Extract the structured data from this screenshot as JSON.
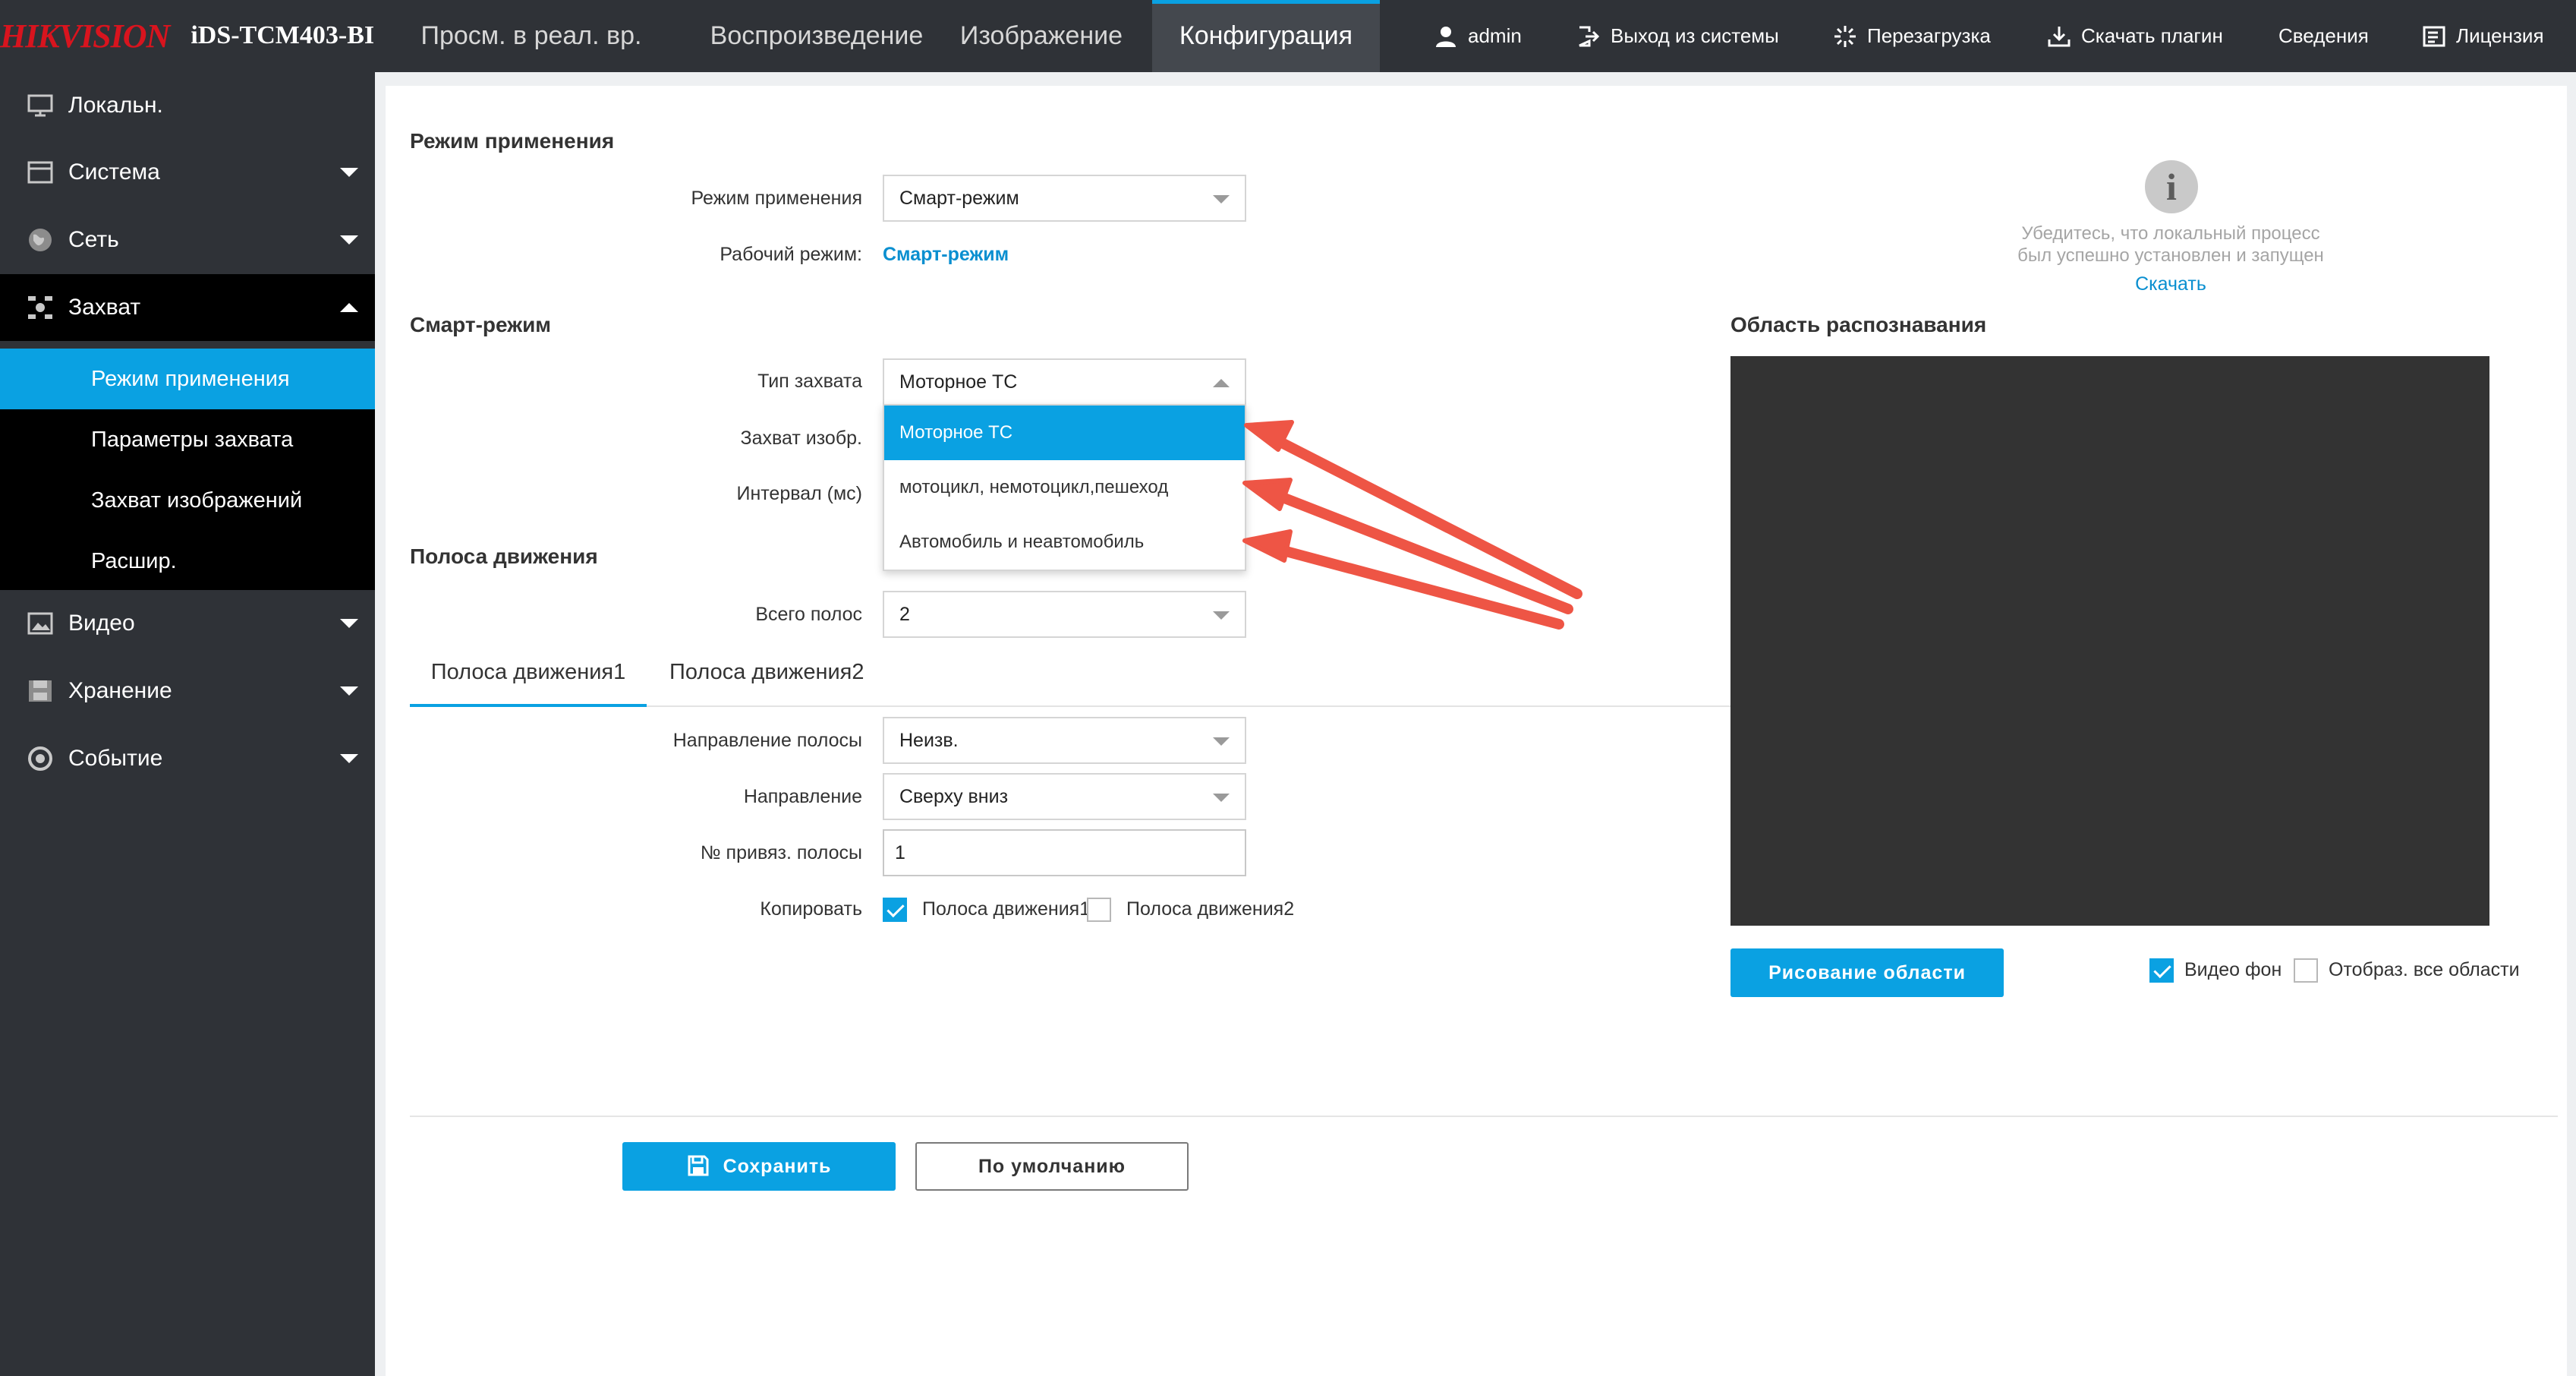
{
  "brand": {
    "logo": "HIKVISION",
    "model": "iDS-TCM403-BI"
  },
  "nav": {
    "tabs": [
      {
        "label": "Просм. в реал. вр."
      },
      {
        "label": "Воспроизведение"
      },
      {
        "label": "Изображение"
      },
      {
        "label": "Конфигурация"
      }
    ],
    "active_tab": "Конфигурация"
  },
  "top_actions": [
    {
      "label": "admin",
      "icon": "user-icon"
    },
    {
      "label": "Выход из системы",
      "icon": "logout-icon"
    },
    {
      "label": "Перезагрузка",
      "icon": "reboot-icon"
    },
    {
      "label": "Скачать плагин",
      "icon": "download-icon"
    },
    {
      "label": "Сведения",
      "icon": ""
    },
    {
      "label": "Лицензия",
      "icon": "license-icon"
    }
  ],
  "sidebar": {
    "items": [
      {
        "label": "Локальн.",
        "icon": "monitor-icon",
        "expandable": false
      },
      {
        "label": "Система",
        "icon": "system-icon",
        "expandable": true
      },
      {
        "label": "Сеть",
        "icon": "globe-icon",
        "expandable": true
      },
      {
        "label": "Захват",
        "icon": "capture-icon",
        "expandable": true,
        "open": true
      },
      {
        "label": "Видео",
        "icon": "video-icon",
        "expandable": true
      },
      {
        "label": "Хранение",
        "icon": "storage-icon",
        "expandable": true
      },
      {
        "label": "Событие",
        "icon": "event-icon",
        "expandable": true
      }
    ],
    "sub_items": [
      {
        "label": "Режим применения",
        "active": true
      },
      {
        "label": "Параметры захвата"
      },
      {
        "label": "Захват изображений"
      },
      {
        "label": "Расшир."
      }
    ]
  },
  "app_mode": {
    "section_title": "Режим применения",
    "mode_label": "Режим применения",
    "mode_value": "Смарт-режим",
    "work_mode_label": "Рабочий режим:",
    "work_mode_value": "Смарт-режим"
  },
  "smart": {
    "section_title": "Смарт-режим",
    "capture_type_label": "Тип захвата",
    "capture_type_value": "Моторное ТС",
    "capture_image_label": "Захват изобр.",
    "interval_label": "Интервал (мс)",
    "dropdown_options": [
      "Моторное ТС",
      "мотоцикл, немотоцикл,пешеход",
      "Автомобиль и неавтомобиль"
    ],
    "dropdown_selected": 0
  },
  "lanes": {
    "section_title": "Полоса движения",
    "total_label": "Всего полос",
    "total_value": "2",
    "tabs": [
      "Полоса движения1",
      "Полоса движения2"
    ],
    "active_tab": 0,
    "direction_label": "Направление полосы",
    "direction_value": "Неизв.",
    "dir2_label": "Направление",
    "dir2_value": "Сверху вниз",
    "bind_label": "№ привяз. полосы",
    "bind_value": "1",
    "copy_label": "Копировать",
    "copy_options": [
      {
        "label": "Полоса движения1",
        "checked": true
      },
      {
        "label": "Полоса движения2",
        "checked": false
      }
    ]
  },
  "right_panel": {
    "info_line1": "Убедитесь, что локальный процесс",
    "info_line2": "был успешно установлен и запущен",
    "download_link": "Скачать",
    "area_title": "Область распознавания",
    "draw_button": "Рисование области",
    "video_bg_label": "Видео фон",
    "video_bg_checked": true,
    "show_all_label": "Отобраз. все области",
    "show_all_checked": false
  },
  "footer": {
    "save_label": "Сохранить",
    "default_label": "По умолчанию"
  },
  "colors": {
    "accent": "#0aa1e2",
    "topbar": "#2f3237",
    "sidebar_open": "#000000",
    "arrow": "#ee5545",
    "video": "#333333"
  }
}
